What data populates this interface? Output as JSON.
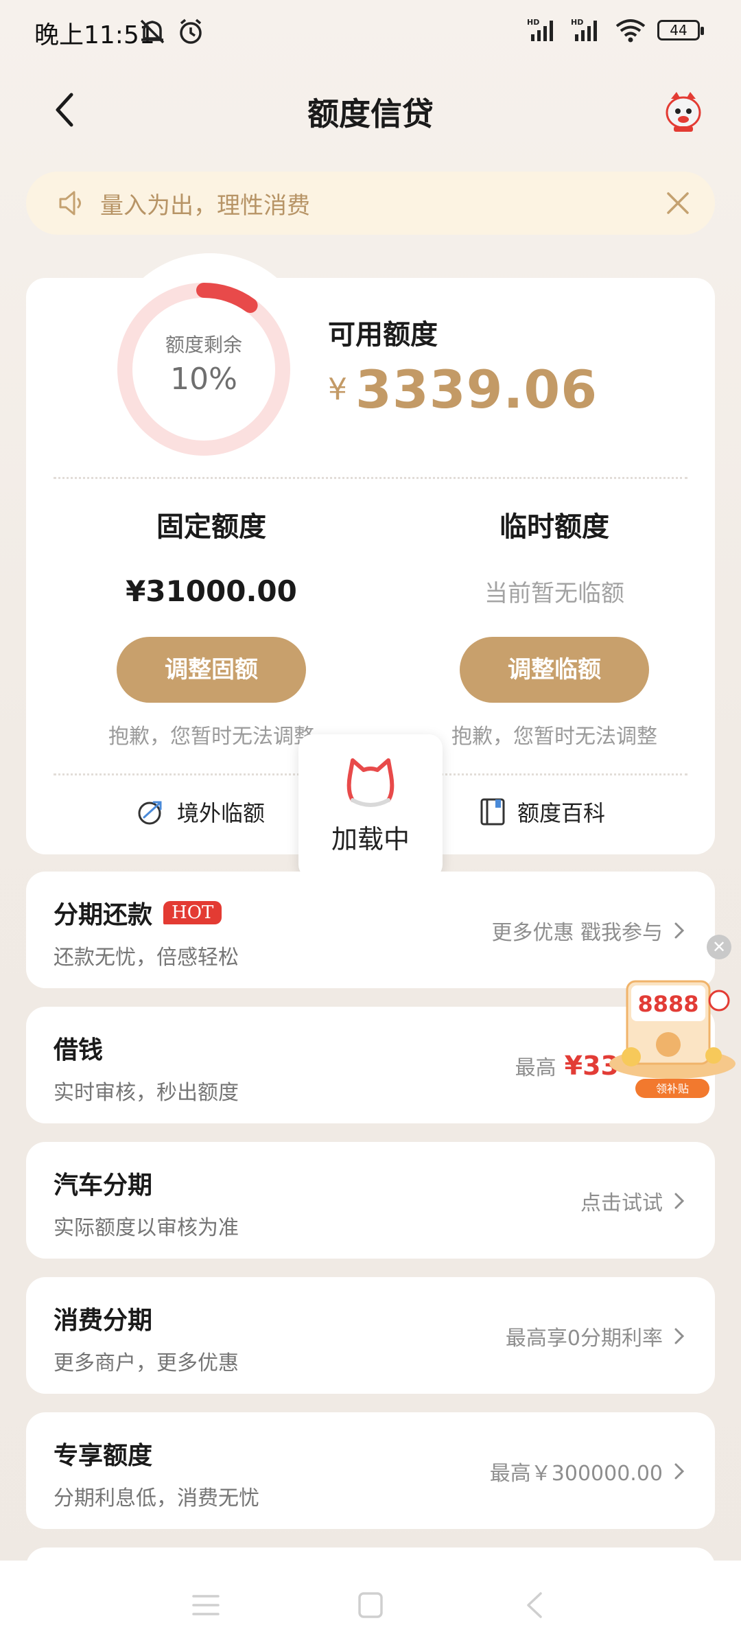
{
  "status_bar": {
    "time": "晚上11:51",
    "battery": "44",
    "icons": [
      "mute-icon",
      "alarm-icon",
      "hd-signal-icon",
      "hd-signal-icon",
      "wifi-icon",
      "battery-icon"
    ]
  },
  "header": {
    "title": "额度信贷",
    "icons": [
      "back-arrow-icon",
      "mascot-icon"
    ]
  },
  "notice": {
    "text": "量入为出，理性消费",
    "icons": [
      "speaker-icon",
      "close-icon"
    ]
  },
  "credit": {
    "ring_label": "额度剩余",
    "ring_value": "10%",
    "remaining_fraction": 0.1,
    "available_title": "可用额度",
    "currency": "¥",
    "available_amount": "3339.06",
    "fixed": {
      "title": "固定额度",
      "value": "¥31000.00",
      "button": "调整固额",
      "hint": "抱歉，您暂时无法调整"
    },
    "temp": {
      "title": "临时额度",
      "value": "当前暂无临额",
      "button": "调整临额",
      "hint": "抱歉，您暂时无法调整"
    },
    "links": [
      {
        "label": "境外临额",
        "icon": "globe-plane-icon"
      },
      {
        "label": "额度百科",
        "icon": "book-icon"
      }
    ]
  },
  "loading": {
    "text": "加载中"
  },
  "list": [
    {
      "title": "分期还款",
      "badge": "HOT",
      "sub": "还款无忧，倍感轻松",
      "right": "更多优惠 戳我参与"
    },
    {
      "title": "借钱",
      "sub": "实时审核，秒出额度",
      "right_prefix": "最高",
      "right_highlight": "¥33"
    },
    {
      "title": "汽车分期",
      "sub": "实际额度以审核为准",
      "right": "点击试试"
    },
    {
      "title": "消费分期",
      "sub": "更多商户，更多优惠",
      "right": "最高享0分期利率"
    },
    {
      "title": "专享额度",
      "sub": "分期利息低，消费无忧",
      "right": "最高￥300000.00"
    }
  ],
  "promo": {
    "amount": "8888",
    "button": "领补贴",
    "icons": [
      "close-icon",
      "red-envelope-icon"
    ]
  },
  "colors": {
    "accent": "#c8a06c",
    "gold_text": "#c39a66",
    "ring": "#e84a4a",
    "ring_track": "#fbe0df",
    "hot": "#e33b33",
    "notice_bg": "#fcf3e2"
  },
  "nav_icons": [
    "menu-icon",
    "home-icon",
    "back-icon"
  ]
}
